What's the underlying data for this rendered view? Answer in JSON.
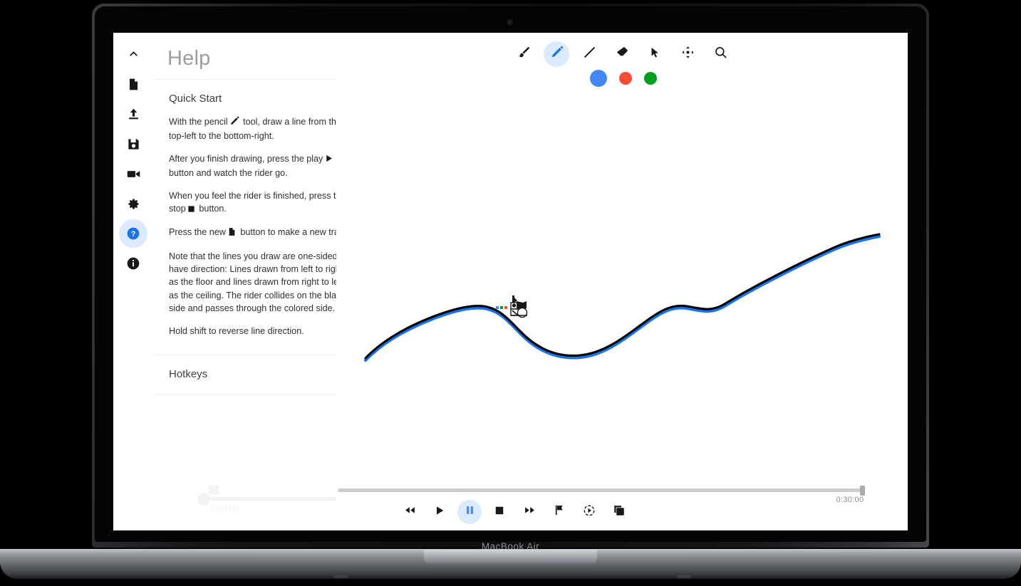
{
  "device": {
    "model_label": "MacBook Air"
  },
  "rail": {
    "items": [
      {
        "name": "collapse-rail",
        "icon": "chevron-up-icon",
        "label": "Collapse",
        "active": false
      },
      {
        "name": "new-track",
        "icon": "document-icon",
        "label": "New Track",
        "active": false
      },
      {
        "name": "load-track",
        "icon": "upload-icon",
        "label": "Load Track",
        "active": false
      },
      {
        "name": "save-track",
        "icon": "save-icon",
        "label": "Save Track",
        "active": false
      },
      {
        "name": "record-video",
        "icon": "video-camera-icon",
        "label": "Record",
        "active": false
      },
      {
        "name": "settings",
        "icon": "gear-icon",
        "label": "Settings",
        "active": false
      },
      {
        "name": "help",
        "icon": "question-mark-icon",
        "label": "Help",
        "active": true
      },
      {
        "name": "about",
        "icon": "info-icon",
        "label": "About",
        "active": false
      }
    ]
  },
  "help_panel": {
    "title": "Help",
    "collapse_icon": "chevron-left-icon",
    "sections": [
      {
        "title": "Quick Start",
        "expanded": true,
        "chevron": "chevron-up-icon",
        "paragraphs": [
          {
            "before": "With the pencil",
            "icon": "pencil-icon",
            "after": "tool, draw a line from the top-left to the bottom-right."
          },
          {
            "before": "After you finish drawing, press the play",
            "icon": "play-icon",
            "after": "button and watch the rider go."
          },
          {
            "before": "When you feel the rider is finished, press the stop",
            "icon": "stop-icon",
            "after": "button."
          },
          {
            "before": "Press the new",
            "icon": "document-icon",
            "after": "button to make a new track."
          },
          {
            "before": "Note that the lines you draw are one-sided and have direction: Lines drawn from left to right act as the floor and lines drawn from right to left act as the ceiling. The rider collides on the black side and passes through the colored side.",
            "icon": "",
            "after": ""
          },
          {
            "before": "Hold shift to reverse line direction.",
            "icon": "",
            "after": ""
          }
        ]
      },
      {
        "title": "Hotkeys",
        "expanded": false,
        "chevron": "chevron-down-icon",
        "paragraphs": []
      }
    ]
  },
  "toolbar": {
    "tools": [
      {
        "name": "brush-tool",
        "icon": "brush-icon",
        "label": "Brush",
        "active": false
      },
      {
        "name": "pencil-tool",
        "icon": "pencil-icon",
        "label": "Pencil",
        "active": true
      },
      {
        "name": "line-tool",
        "icon": "line-icon",
        "label": "Line",
        "active": false
      },
      {
        "name": "eraser-tool",
        "icon": "eraser-icon",
        "label": "Eraser",
        "active": false
      },
      {
        "name": "select-tool",
        "icon": "cursor-arrow-icon",
        "label": "Select",
        "active": false
      },
      {
        "name": "pan-tool",
        "icon": "move-icon",
        "label": "Pan",
        "active": false
      },
      {
        "name": "zoom-tool",
        "icon": "magnifier-icon",
        "label": "Zoom",
        "active": false
      }
    ],
    "colors": [
      {
        "name": "color-blue",
        "hex": "#4287f5",
        "label": "Blue",
        "selected": true
      },
      {
        "name": "color-red",
        "hex": "#fc4b35",
        "label": "Red",
        "selected": false
      },
      {
        "name": "color-green",
        "hex": "#00a01e",
        "label": "Green",
        "selected": false
      }
    ]
  },
  "canvas": {
    "track_line_color": "#000000",
    "track_accent_color": "#1a73e8",
    "rider_name": "line-rider-sprite"
  },
  "playback": {
    "time": "0:30:00",
    "progress_percent": 99,
    "buttons": [
      {
        "name": "rewind-button",
        "icon": "rewind-icon",
        "label": "Rewind",
        "active": false
      },
      {
        "name": "play-button",
        "icon": "play-icon",
        "label": "Play",
        "active": false
      },
      {
        "name": "pause-button",
        "icon": "pause-icon",
        "label": "Pause",
        "active": true
      },
      {
        "name": "stop-button",
        "icon": "stop-icon",
        "label": "Stop",
        "active": false
      },
      {
        "name": "fast-forward-button",
        "icon": "fast-forward-icon",
        "label": "Fast Forward",
        "active": false
      },
      {
        "name": "flag-button",
        "icon": "flag-icon",
        "label": "Flag",
        "active": false
      },
      {
        "name": "slowmo-button",
        "icon": "slow-motion-icon",
        "label": "Slow Motion",
        "active": false
      },
      {
        "name": "layers-button",
        "icon": "layers-icon",
        "label": "Layers",
        "active": false
      }
    ]
  },
  "ghost_timeline": {
    "time": "0:00:00"
  }
}
